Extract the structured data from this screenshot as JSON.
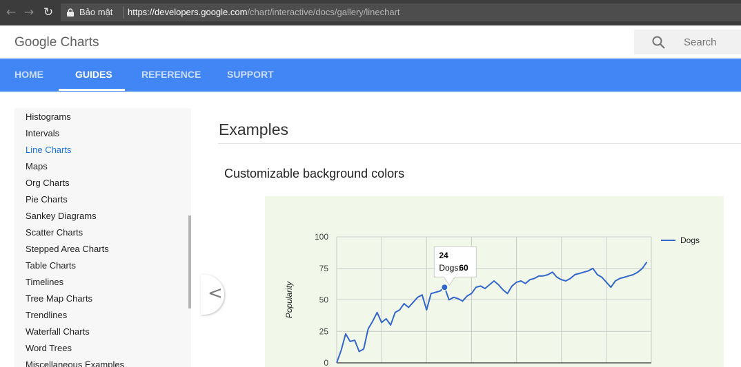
{
  "browser": {
    "secure_label": "Bảo mật",
    "url_domain": "https://developers.google.com",
    "url_path": "/chart/interactive/docs/gallery/linechart"
  },
  "header": {
    "brand": "Google Charts",
    "search_placeholder": "Search"
  },
  "tabs": [
    {
      "label": "HOME"
    },
    {
      "label": "GUIDES"
    },
    {
      "label": "REFERENCE"
    },
    {
      "label": "SUPPORT"
    }
  ],
  "sidebar": {
    "active": "Line Charts",
    "items": [
      "Histograms",
      "Intervals",
      "Line Charts",
      "Maps",
      "Org Charts",
      "Pie Charts",
      "Sankey Diagrams",
      "Scatter Charts",
      "Stepped Area Charts",
      "Table Charts",
      "Timelines",
      "Tree Map Charts",
      "Trendlines",
      "Waterfall Charts",
      "Word Trees",
      "Miscellaneous Examples"
    ]
  },
  "main": {
    "heading": "Examples",
    "section_title": "Customizable background colors",
    "collapse_label": "<"
  },
  "colors": {
    "tab_bar": "#4285f4",
    "chart_background": "#f1f8e9",
    "series": "#3366cc",
    "active_link": "#1a73e8"
  },
  "chart_data": {
    "type": "line",
    "ylabel": "Popularity",
    "xlabel": "",
    "title": "",
    "ylim": [
      0,
      100
    ],
    "yticks": [
      0,
      25,
      50,
      75,
      100
    ],
    "xlim": [
      0,
      70
    ],
    "legend_position": "right",
    "grid": true,
    "series": [
      {
        "name": "Dogs",
        "x": [
          0,
          1,
          2,
          3,
          4,
          5,
          6,
          7,
          8,
          9,
          10,
          11,
          12,
          13,
          14,
          15,
          16,
          17,
          18,
          19,
          20,
          21,
          22,
          23,
          24,
          25,
          26,
          27,
          28,
          29,
          30,
          31,
          32,
          33,
          34,
          35,
          36,
          37,
          38,
          39,
          40,
          41,
          42,
          43,
          44,
          45,
          46,
          47,
          48,
          49,
          50,
          51,
          52,
          53,
          54,
          55,
          56,
          57,
          58,
          59,
          60,
          61,
          62,
          63,
          64,
          65,
          66,
          67,
          68,
          69
        ],
        "y": [
          0,
          10,
          23,
          17,
          18,
          9,
          11,
          27,
          33,
          40,
          32,
          35,
          30,
          40,
          42,
          47,
          44,
          48,
          52,
          54,
          42,
          55,
          56,
          57,
          60,
          50,
          52,
          51,
          49,
          53,
          55,
          60,
          61,
          59,
          62,
          65,
          62,
          58,
          55,
          61,
          64,
          65,
          63,
          66,
          67,
          69,
          69,
          70,
          72,
          68,
          66,
          65,
          67,
          70,
          71,
          72,
          73,
          75,
          70,
          68,
          64,
          60,
          65,
          67,
          68,
          69,
          70,
          72,
          75,
          80
        ]
      }
    ],
    "tooltip": {
      "title": "24",
      "label": "Dogs:",
      "value": "60",
      "x": 24
    }
  }
}
